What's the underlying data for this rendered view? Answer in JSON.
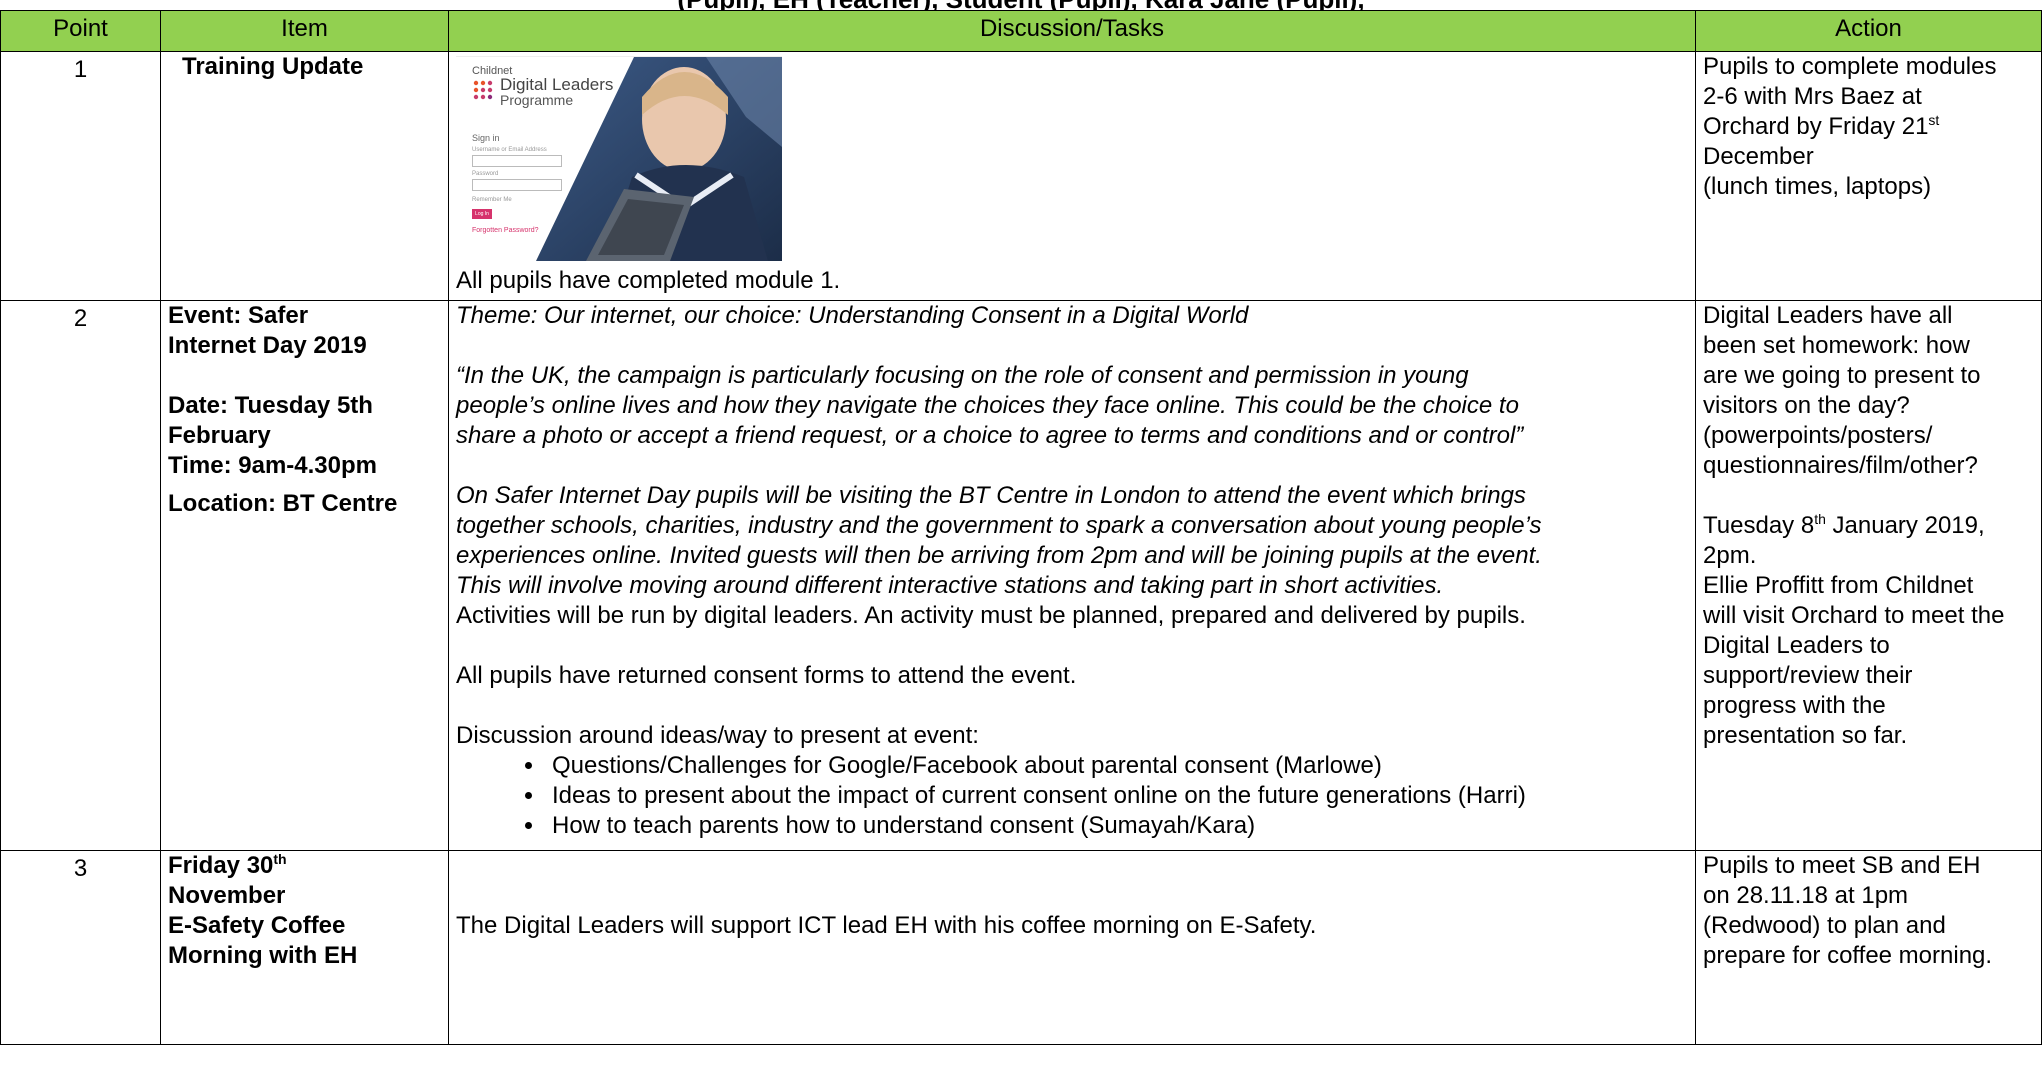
{
  "doc": {
    "clipped_title": "(Pupil), EH (Teacher), Student (Pupil), Kara Jane (Pupil),"
  },
  "table": {
    "headers": {
      "point": "Point",
      "item": "Item",
      "discussion": "Discussion/Tasks",
      "action": "Action"
    },
    "rows": [
      {
        "point": "1",
        "item": "Training Update",
        "image": {
          "brand": "Childnet",
          "title": "Digital Leaders",
          "subtitle": "Programme",
          "signin": "Sign in",
          "field1": "Username or Email Address",
          "field2": "Password",
          "remember": "Remember Me",
          "button": "Log In",
          "forgot": "Forgotten Password?"
        },
        "discussion": "All pupils have completed module 1.",
        "action": {
          "l1": "Pupils to complete modules",
          "l2": "2-6 with Mrs Baez at",
          "l3": "Orchard by Friday 21",
          "sup": "st",
          "l4": "December",
          "l5": "(lunch times, laptops)"
        }
      },
      {
        "point": "2",
        "item": {
          "event1": "Event: Safer",
          "event2": "Internet Day 2019",
          "date1": "Date: Tuesday 5th",
          "date2": "February",
          "time": "Time: 9am-4.30pm",
          "location": "Location: BT Centre"
        },
        "discussion": {
          "theme": "Theme: Our internet, our choice: Understanding Consent in a Digital World",
          "quote1": "“In the UK, the campaign is particularly focusing on the role of consent and permission in young",
          "quote2": "people’s online lives and how they navigate the choices they face online. This could be the choice to",
          "quote3": "share a photo or accept a friend request, or a choice to agree to terms and conditions and or control”",
          "para1": "On Safer Internet Day pupils will be visiting the BT Centre in London to attend the event which brings",
          "para2": "together schools, charities, industry and the government to spark a conversation about young people’s",
          "para3": "experiences online. Invited guests will then be arriving from 2pm and will be joining pupils at the event.",
          "para4": "This will involve moving around different interactive stations and taking part in short activities.",
          "activities": "Activities will be run by digital leaders. An activity must be planned, prepared and delivered by pupils.",
          "consent": "All pupils have returned consent forms to attend the event.",
          "ideas_intro": "Discussion around ideas/way to present at event:",
          "bullets": [
            "Questions/Challenges for Google/Facebook about parental consent (Marlowe)",
            "Ideas to present about the impact of current consent online on the future generations (Harri)",
            "How to teach parents how to understand consent (Sumayah/Kara)"
          ]
        },
        "action": {
          "a1": "Digital Leaders have all",
          "a2": "been set homework: how",
          "a3": "are we going to present to",
          "a4": "visitors on the day?",
          "a5": "(powerpoints/posters/",
          "a6": "questionnaires/film/other?",
          "b1": "Tuesday 8",
          "b1sup": "th",
          "b1end": " January 2019,",
          "b2": "2pm.",
          "b3": "Ellie Proffitt from Childnet",
          "b4": "will visit Orchard to meet the",
          "b5": "Digital Leaders to",
          "b6": "support/review their",
          "b7": "progress with the",
          "b8": "presentation so far."
        }
      },
      {
        "point": "3",
        "item": {
          "l1": "Friday 30",
          "l1sup": "th",
          "l2": "November",
          "l3": "E-Safety Coffee",
          "l4": "Morning with EH"
        },
        "discussion": "The Digital Leaders will support ICT lead EH with his coffee morning on E-Safety.",
        "action": {
          "l1": "Pupils to meet SB and EH",
          "l2": "on 28.11.18 at 1pm",
          "l3": "(Redwood) to plan and",
          "l4": "prepare for coffee morning."
        }
      }
    ]
  }
}
